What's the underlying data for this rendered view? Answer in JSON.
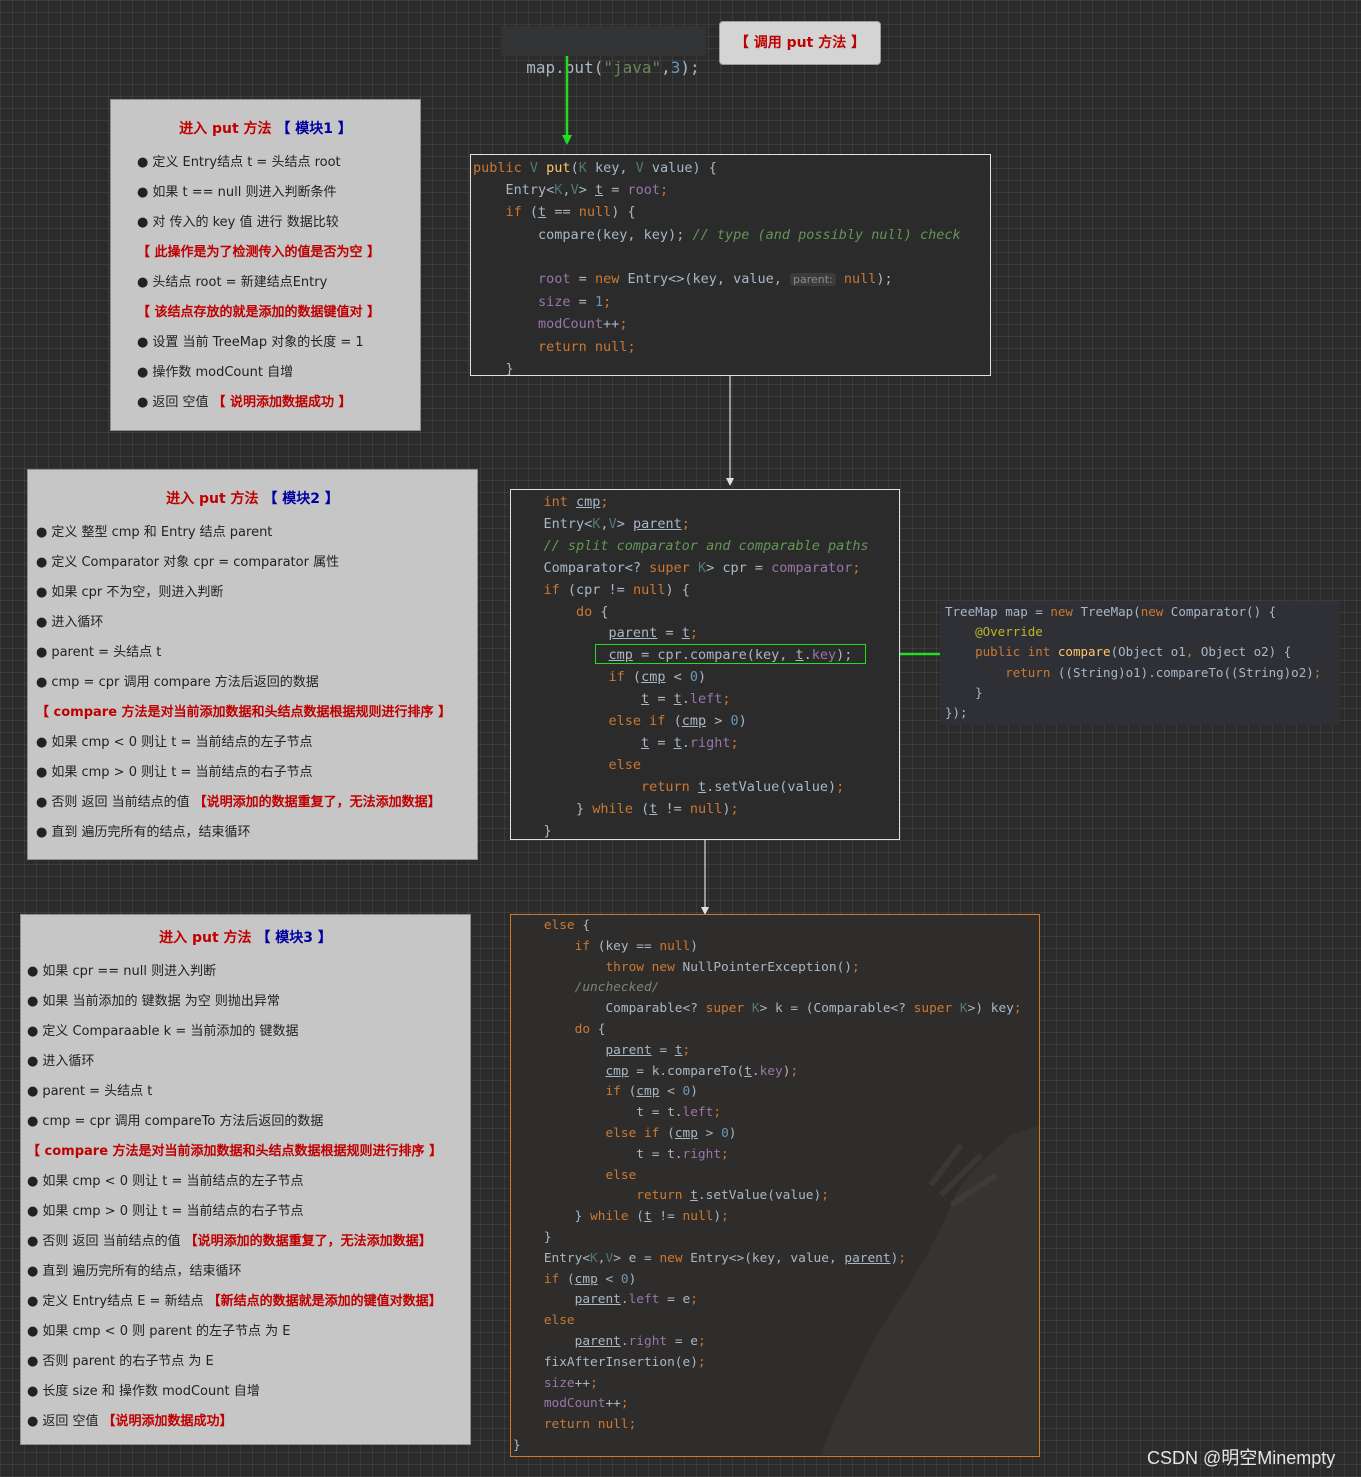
{
  "top": {
    "call_code": [
      "map.put(",
      "\"java\"",
      ",",
      "3",
      ");"
    ],
    "call_label": "【 调用 put 方法 】"
  },
  "note1": {
    "title_a": "进入 put 方法",
    "title_b": "【 模块1 】",
    "items": [
      {
        "text": "定义 Entry结点 t = 头结点 root"
      },
      {
        "text": "如果 t == null 则进入判断条件"
      },
      {
        "text": "对 传入的 key 值 进行 数据比较"
      },
      {
        "text": "【 此操作是为了检测传入的值是否为空 】",
        "red": true
      },
      {
        "text": "头结点 root = 新建结点Entry"
      },
      {
        "text": "【 该结点存放的就是添加的数据键值对 】",
        "red": true
      },
      {
        "text": "设置 当前 TreeMap 对象的长度 = 1"
      },
      {
        "text": "操作数 modCount 自增"
      },
      {
        "text": "返回 空值",
        "suffix": "【 说明添加数据成功 】"
      }
    ]
  },
  "note2": {
    "title_a": "进入 put 方法",
    "title_b": "【 模块2 】",
    "items": [
      {
        "text": "定义 整型 cmp 和 Entry 结点 parent"
      },
      {
        "text": "定义 Comparator 对象 cpr = comparator 属性"
      },
      {
        "text": "如果 cpr 不为空，则进入判断"
      },
      {
        "text": "进入循环"
      },
      {
        "text": "parent = 头结点 t"
      },
      {
        "text": "cmp = cpr 调用 compare 方法后返回的数据"
      },
      {
        "text": "【 compare 方法是对当前添加数据和头结点数据根据规则进行排序 】",
        "red": true
      },
      {
        "text": "如果 cmp < 0 则让 t = 当前结点的左子节点"
      },
      {
        "text": "如果 cmp > 0 则让 t = 当前结点的右子节点"
      },
      {
        "text": "否则 返回 当前结点的值",
        "suffix": "【说明添加的数据重复了，无法添加数据】"
      },
      {
        "text": "直到 遍历完所有的结点，结束循环"
      }
    ]
  },
  "note3": {
    "title_a": "进入 put 方法",
    "title_b": "【 模块3 】",
    "items": [
      {
        "text": "如果 cpr == null 则进入判断"
      },
      {
        "text": "如果 当前添加的 键数据 为空 则抛出异常"
      },
      {
        "text": "定义 Comparaable k = 当前添加的 键数据"
      },
      {
        "text": "进入循环"
      },
      {
        "text": "parent = 头结点 t"
      },
      {
        "text": "cmp = cpr 调用 compareTo 方法后返回的数据"
      },
      {
        "text": "【 compare 方法是对当前添加数据和头结点数据根据规则进行排序 】",
        "red": true
      },
      {
        "text": "如果 cmp < 0 则让 t = 当前结点的左子节点"
      },
      {
        "text": "如果 cmp > 0 则让 t = 当前结点的右子节点"
      },
      {
        "text": "否则 返回 当前结点的值",
        "suffix": "【说明添加的数据重复了，无法添加数据】"
      },
      {
        "text": "直到 遍历完所有的结点，结束循环"
      },
      {
        "text": "定义 Entry结点 E = 新结点",
        "suffix": "【新结点的数据就是添加的键值对数据】"
      },
      {
        "text": "如果 cmp < 0 则 parent 的左子节点 为 E"
      },
      {
        "text": "否则 parent 的右子节点 为 E"
      },
      {
        "text": "长度 size 和 操作数 modCount 自增"
      },
      {
        "text": "返回 空值",
        "suffix": "【说明添加数据成功】"
      }
    ]
  },
  "code1": [
    [
      [
        "kw",
        "public "
      ],
      [
        "gen",
        "V "
      ],
      [
        "fn",
        "put"
      ],
      [
        "",
        "("
      ],
      [
        "gen",
        "K "
      ],
      [
        "",
        "key, "
      ],
      [
        "gen",
        "V "
      ],
      [
        "",
        "value) {"
      ]
    ],
    [
      [
        "",
        "    Entry<"
      ],
      [
        "gen",
        "K"
      ],
      [
        "",
        ","
      ],
      [
        "gen",
        "V"
      ],
      [
        "",
        "> "
      ],
      [
        "ul",
        "t"
      ],
      [
        "",
        " = "
      ],
      [
        "fld",
        "root"
      ],
      [
        "kw",
        ";"
      ]
    ],
    [
      [
        "kw",
        "    if "
      ],
      [
        "",
        "("
      ],
      [
        "ul",
        "t"
      ],
      [
        "",
        " == "
      ],
      [
        "kw",
        "null"
      ],
      [
        "",
        ") {"
      ]
    ],
    [
      [
        "",
        "        compare(key, key); "
      ],
      [
        "cmt",
        "// type (and possibly null) check"
      ]
    ],
    [
      [
        "",
        ""
      ]
    ],
    [
      [
        "fld",
        "        root"
      ],
      [
        "",
        " = "
      ],
      [
        "kw",
        "new "
      ],
      [
        "",
        "Entry<>(key, value, "
      ],
      [
        "hint",
        "parent:"
      ],
      [
        "kw",
        " null"
      ],
      [
        "",
        ");"
      ]
    ],
    [
      [
        "fld",
        "        size"
      ],
      [
        "",
        " = "
      ],
      [
        "num",
        "1"
      ],
      [
        "kw",
        ";"
      ]
    ],
    [
      [
        "fld",
        "        modCount"
      ],
      [
        "",
        "++"
      ],
      [
        "kw",
        ";"
      ]
    ],
    [
      [
        "kw",
        "        return null"
      ],
      [
        "kw",
        ";"
      ]
    ],
    [
      [
        "",
        "    }"
      ]
    ]
  ],
  "code2": [
    [
      [
        "kw",
        "    int "
      ],
      [
        "ul",
        "cmp"
      ],
      [
        "kw",
        ";"
      ]
    ],
    [
      [
        "",
        "    Entry<"
      ],
      [
        "gen",
        "K"
      ],
      [
        "",
        ","
      ],
      [
        "gen",
        "V"
      ],
      [
        "",
        "> "
      ],
      [
        "ul",
        "parent"
      ],
      [
        "kw",
        ";"
      ]
    ],
    [
      [
        "cmt",
        "    // split comparator and comparable paths"
      ]
    ],
    [
      [
        "",
        "    Comparator<? "
      ],
      [
        "kw",
        "super "
      ],
      [
        "gen",
        "K"
      ],
      [
        "",
        "> cpr = "
      ],
      [
        "fld",
        "comparator"
      ],
      [
        "kw",
        ";"
      ]
    ],
    [
      [
        "kw",
        "    if "
      ],
      [
        "",
        "(cpr != "
      ],
      [
        "kw",
        "null"
      ],
      [
        "",
        ") {"
      ]
    ],
    [
      [
        "kw",
        "        do "
      ],
      [
        "",
        "{"
      ]
    ],
    [
      [
        "",
        "            "
      ],
      [
        "ul",
        "parent"
      ],
      [
        "",
        " = "
      ],
      [
        "ul",
        "t"
      ],
      [
        "kw",
        ";"
      ]
    ],
    [
      [
        "",
        "            "
      ],
      [
        "ul",
        "cmp"
      ],
      [
        "",
        " = cpr.compare(key, "
      ],
      [
        "ul",
        "t"
      ],
      [
        "",
        "."
      ],
      [
        "fld",
        "key"
      ],
      [
        "",
        ");"
      ]
    ],
    [
      [
        "kw",
        "            if "
      ],
      [
        "",
        "("
      ],
      [
        "ul",
        "cmp"
      ],
      [
        "",
        " < "
      ],
      [
        "num",
        "0"
      ],
      [
        "",
        ")"
      ]
    ],
    [
      [
        "",
        "                "
      ],
      [
        "ul",
        "t"
      ],
      [
        "",
        " = "
      ],
      [
        "ul",
        "t"
      ],
      [
        "",
        "."
      ],
      [
        "fld",
        "left"
      ],
      [
        "kw",
        ";"
      ]
    ],
    [
      [
        "kw",
        "            else if "
      ],
      [
        "",
        "("
      ],
      [
        "ul",
        "cmp"
      ],
      [
        "",
        " > "
      ],
      [
        "num",
        "0"
      ],
      [
        "",
        ")"
      ]
    ],
    [
      [
        "",
        "                "
      ],
      [
        "ul",
        "t"
      ],
      [
        "",
        " = "
      ],
      [
        "ul",
        "t"
      ],
      [
        "",
        "."
      ],
      [
        "fld",
        "right"
      ],
      [
        "kw",
        ";"
      ]
    ],
    [
      [
        "kw",
        "            else"
      ]
    ],
    [
      [
        "kw",
        "                return "
      ],
      [
        "ul",
        "t"
      ],
      [
        "",
        ".setValue(value)"
      ],
      [
        "kw",
        ";"
      ]
    ],
    [
      [
        "",
        "        } "
      ],
      [
        "kw",
        "while "
      ],
      [
        "",
        "("
      ],
      [
        "ul",
        "t"
      ],
      [
        "",
        " != "
      ],
      [
        "kw",
        "null"
      ],
      [
        "",
        ")"
      ],
      [
        "kw",
        ";"
      ]
    ],
    [
      [
        "",
        "    }"
      ]
    ]
  ],
  "code3": [
    [
      [
        "",
        "TreeMap map = "
      ],
      [
        "kw",
        "new "
      ],
      [
        "",
        "TreeMap("
      ],
      [
        "kw",
        "new "
      ],
      [
        "",
        "Comparator() {"
      ]
    ],
    [
      [
        "ann",
        "    @Override"
      ]
    ],
    [
      [
        "kw",
        "    public int "
      ],
      [
        "fn",
        "compare"
      ],
      [
        "",
        "(Object o1"
      ],
      [
        "kw",
        ", "
      ],
      [
        "",
        "Object o2) {"
      ]
    ],
    [
      [
        "kw",
        "        return "
      ],
      [
        "",
        "((String)o1).compareTo((String)o2)"
      ],
      [
        "kw",
        ";"
      ]
    ],
    [
      [
        "",
        "    }"
      ]
    ],
    [
      [
        "",
        "});"
      ]
    ]
  ],
  "code4": [
    [
      [
        "kw",
        "    else "
      ],
      [
        "",
        "{"
      ]
    ],
    [
      [
        "kw",
        "        if "
      ],
      [
        "",
        "(key == "
      ],
      [
        "kw",
        "null"
      ],
      [
        "",
        ")"
      ]
    ],
    [
      [
        "kw",
        "            throw new "
      ],
      [
        "",
        "NullPointerException()"
      ],
      [
        "kw",
        ";"
      ]
    ],
    [
      [
        "cmt2",
        "        /unchecked/"
      ]
    ],
    [
      [
        "",
        "            Comparable<? "
      ],
      [
        "kw",
        "super "
      ],
      [
        "gen",
        "K"
      ],
      [
        "",
        "> k = (Comparable<? "
      ],
      [
        "kw",
        "super "
      ],
      [
        "gen",
        "K"
      ],
      [
        "",
        ">) key"
      ],
      [
        "kw",
        ";"
      ]
    ],
    [
      [
        "kw",
        "        do "
      ],
      [
        "",
        "{"
      ]
    ],
    [
      [
        "",
        "            "
      ],
      [
        "ul",
        "parent"
      ],
      [
        "",
        " = "
      ],
      [
        "ul",
        "t"
      ],
      [
        "kw",
        ";"
      ]
    ],
    [
      [
        "",
        "            "
      ],
      [
        "ul",
        "cmp"
      ],
      [
        "",
        " = k.compareTo("
      ],
      [
        "ul",
        "t"
      ],
      [
        "",
        "."
      ],
      [
        "fld",
        "key"
      ],
      [
        "",
        ")"
      ],
      [
        "kw",
        ";"
      ]
    ],
    [
      [
        "kw",
        "            if "
      ],
      [
        "",
        "("
      ],
      [
        "ul",
        "cmp"
      ],
      [
        "",
        " < "
      ],
      [
        "num",
        "0"
      ],
      [
        "",
        ")"
      ]
    ],
    [
      [
        "",
        "                "
      ],
      [
        "",
        "t = t."
      ],
      [
        "fld",
        "left"
      ],
      [
        "kw",
        ";"
      ]
    ],
    [
      [
        "kw",
        "            else if "
      ],
      [
        "",
        "("
      ],
      [
        "ul",
        "cmp"
      ],
      [
        "",
        " > "
      ],
      [
        "num",
        "0"
      ],
      [
        "",
        ")"
      ]
    ],
    [
      [
        "",
        "                "
      ],
      [
        "",
        "t = t."
      ],
      [
        "fld",
        "right"
      ],
      [
        "kw",
        ";"
      ]
    ],
    [
      [
        "kw",
        "            else"
      ]
    ],
    [
      [
        "kw",
        "                return "
      ],
      [
        "ul",
        "t"
      ],
      [
        "",
        ".setValue(value)"
      ],
      [
        "kw",
        ";"
      ]
    ],
    [
      [
        "",
        "        } "
      ],
      [
        "kw",
        "while "
      ],
      [
        "",
        "("
      ],
      [
        "ul",
        "t"
      ],
      [
        "",
        " != "
      ],
      [
        "kw",
        "null"
      ],
      [
        "",
        ")"
      ],
      [
        "kw",
        ";"
      ]
    ],
    [
      [
        "",
        "    }"
      ]
    ],
    [
      [
        "",
        "    Entry<"
      ],
      [
        "gen",
        "K"
      ],
      [
        "",
        ","
      ],
      [
        "gen",
        "V"
      ],
      [
        "",
        "> e = "
      ],
      [
        "kw",
        "new "
      ],
      [
        "",
        "Entry<>(key, value, "
      ],
      [
        "ul",
        "parent"
      ],
      [
        "",
        ")"
      ],
      [
        "kw",
        ";"
      ]
    ],
    [
      [
        "kw",
        "    if "
      ],
      [
        "",
        "("
      ],
      [
        "ul",
        "cmp"
      ],
      [
        "",
        " < "
      ],
      [
        "num",
        "0"
      ],
      [
        "",
        ")"
      ]
    ],
    [
      [
        "",
        "        "
      ],
      [
        "ul",
        "parent"
      ],
      [
        "",
        "."
      ],
      [
        "fld",
        "left"
      ],
      [
        "",
        " = e"
      ],
      [
        "kw",
        ";"
      ]
    ],
    [
      [
        "kw",
        "    else"
      ]
    ],
    [
      [
        "",
        "        "
      ],
      [
        "ul",
        "parent"
      ],
      [
        "",
        "."
      ],
      [
        "fld",
        "right"
      ],
      [
        "",
        " = e"
      ],
      [
        "kw",
        ";"
      ]
    ],
    [
      [
        "",
        "    fixAfterInsertion(e)"
      ],
      [
        "kw",
        ";"
      ]
    ],
    [
      [
        "fld",
        "    size"
      ],
      [
        "",
        "++"
      ],
      [
        "kw",
        ";"
      ]
    ],
    [
      [
        "fld",
        "    modCount"
      ],
      [
        "",
        "++"
      ],
      [
        "kw",
        ";"
      ]
    ],
    [
      [
        "kw",
        "    return null;"
      ]
    ],
    [
      [
        "",
        "}"
      ]
    ]
  ],
  "watermark": "CSDN @明空Minempty"
}
